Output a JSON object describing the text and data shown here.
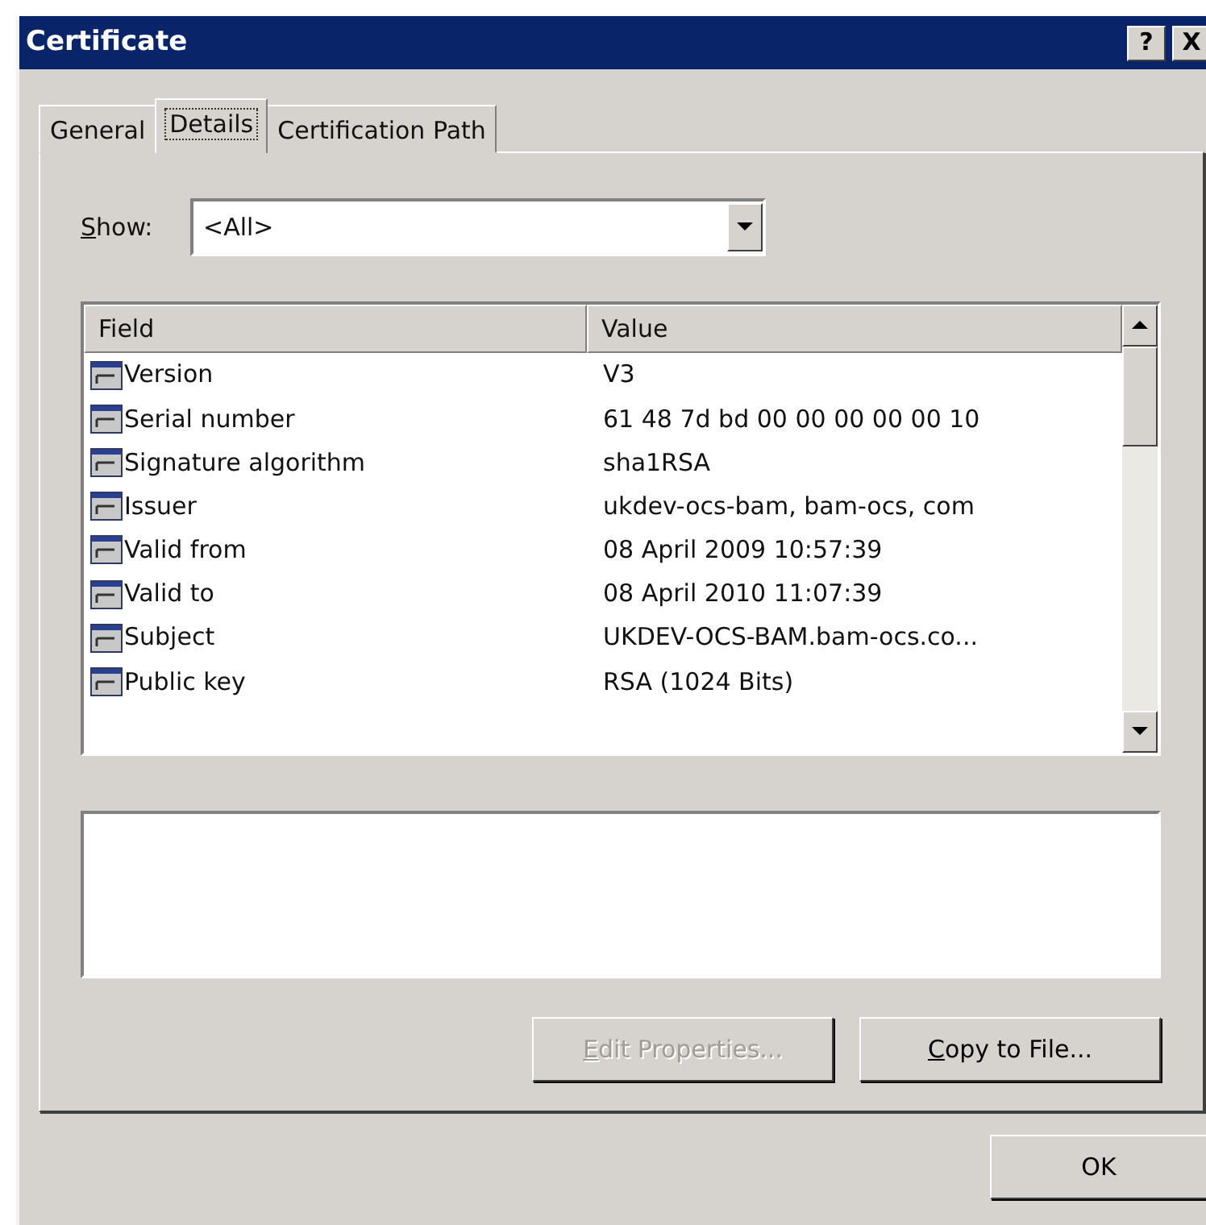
{
  "window": {
    "title": "Certificate",
    "title_buttons": [
      "?",
      "X"
    ]
  },
  "tabs": [
    {
      "label": "General",
      "selected": false
    },
    {
      "label": "Details",
      "selected": true
    },
    {
      "label": "Certification Path",
      "selected": false
    }
  ],
  "show": {
    "label": "Show:",
    "value": "<All>"
  },
  "table": {
    "columns": [
      "Field",
      "Value"
    ],
    "rows": [
      {
        "field": "Version",
        "value": "V3"
      },
      {
        "field": "Serial number",
        "value": "61 48 7d bd 00 00 00 00 00 10"
      },
      {
        "field": "Signature algorithm",
        "value": "sha1RSA"
      },
      {
        "field": "Issuer",
        "value": "ukdev-ocs-bam, bam-ocs, com"
      },
      {
        "field": "Valid from",
        "value": "08 April 2009 10:57:39"
      },
      {
        "field": "Valid to",
        "value": "08 April 2010 11:07:39"
      },
      {
        "field": "Subject",
        "value": "UKDEV-OCS-BAM.bam-ocs.co..."
      },
      {
        "field": "Public key",
        "value": "RSA (1024 Bits)"
      }
    ]
  },
  "buttons": [
    {
      "label": "Edit Properties...",
      "disabled": true
    },
    {
      "label": "Copy to File...",
      "disabled": false
    }
  ],
  "footer_buttons": [
    {
      "label": "OK"
    }
  ]
}
